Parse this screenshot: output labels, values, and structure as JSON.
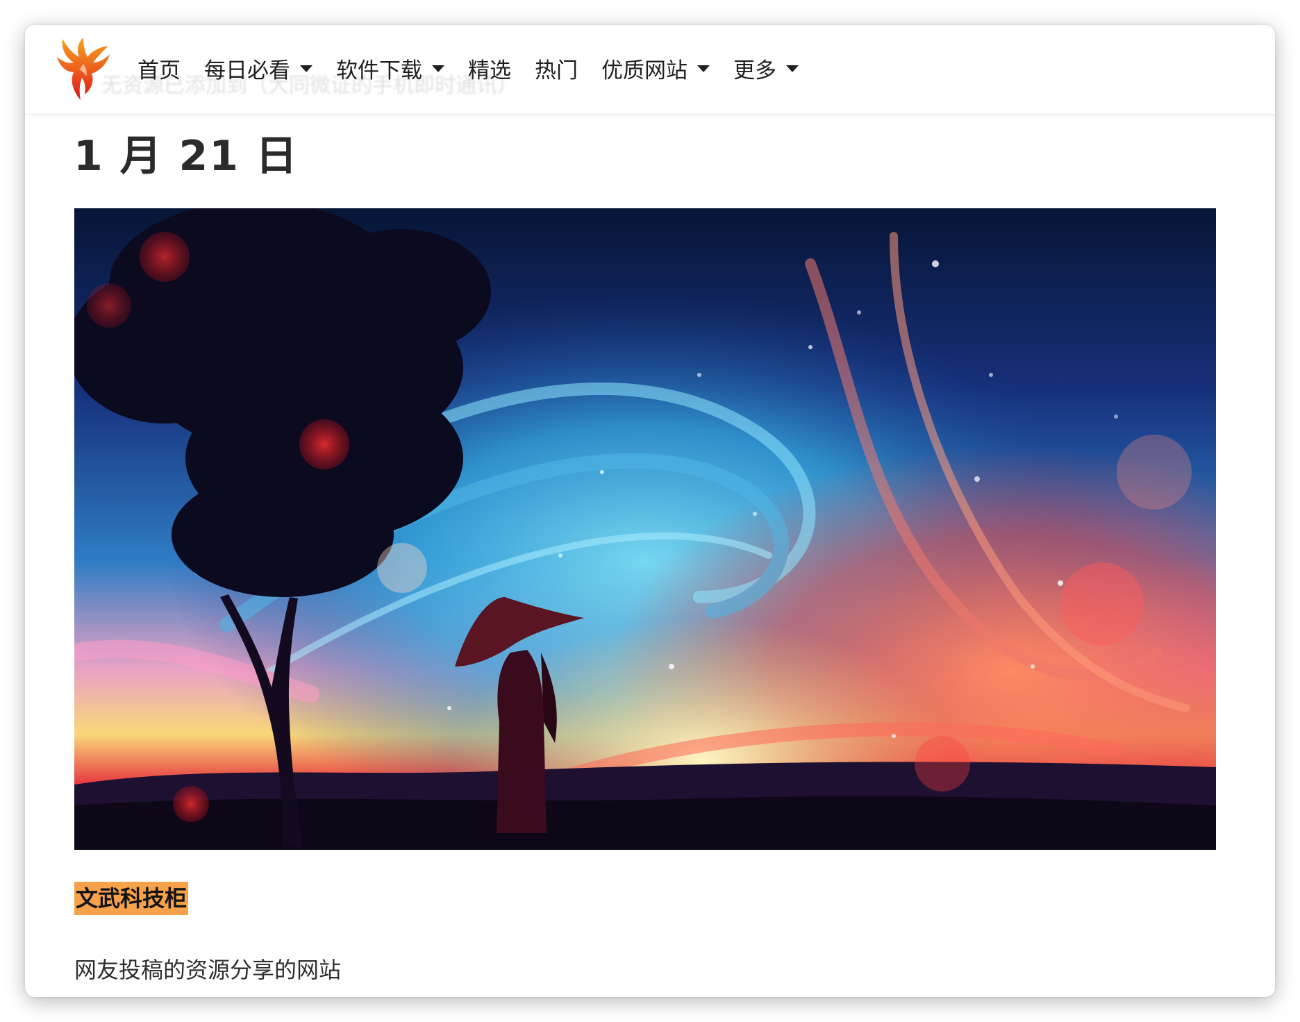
{
  "nav": {
    "items": [
      {
        "label": "首页",
        "dropdown": false
      },
      {
        "label": "每日必看",
        "dropdown": true
      },
      {
        "label": "软件下载",
        "dropdown": true
      },
      {
        "label": "精选",
        "dropdown": false
      },
      {
        "label": "热门",
        "dropdown": false
      },
      {
        "label": "优质网站",
        "dropdown": true
      },
      {
        "label": "更多",
        "dropdown": true
      }
    ],
    "logo_icon": "phoenix-logo-icon",
    "ghost_text": "无资源已添加到（大同微证的手机即时通讯）"
  },
  "post": {
    "date_title": "1 月 21 日",
    "tag": "文武科技柜",
    "description": "网友投稿的资源分享的网站"
  },
  "colors": {
    "tag_bg": "#f7a24a",
    "logo_red": "#e5231b",
    "logo_orange": "#f39a1e"
  }
}
